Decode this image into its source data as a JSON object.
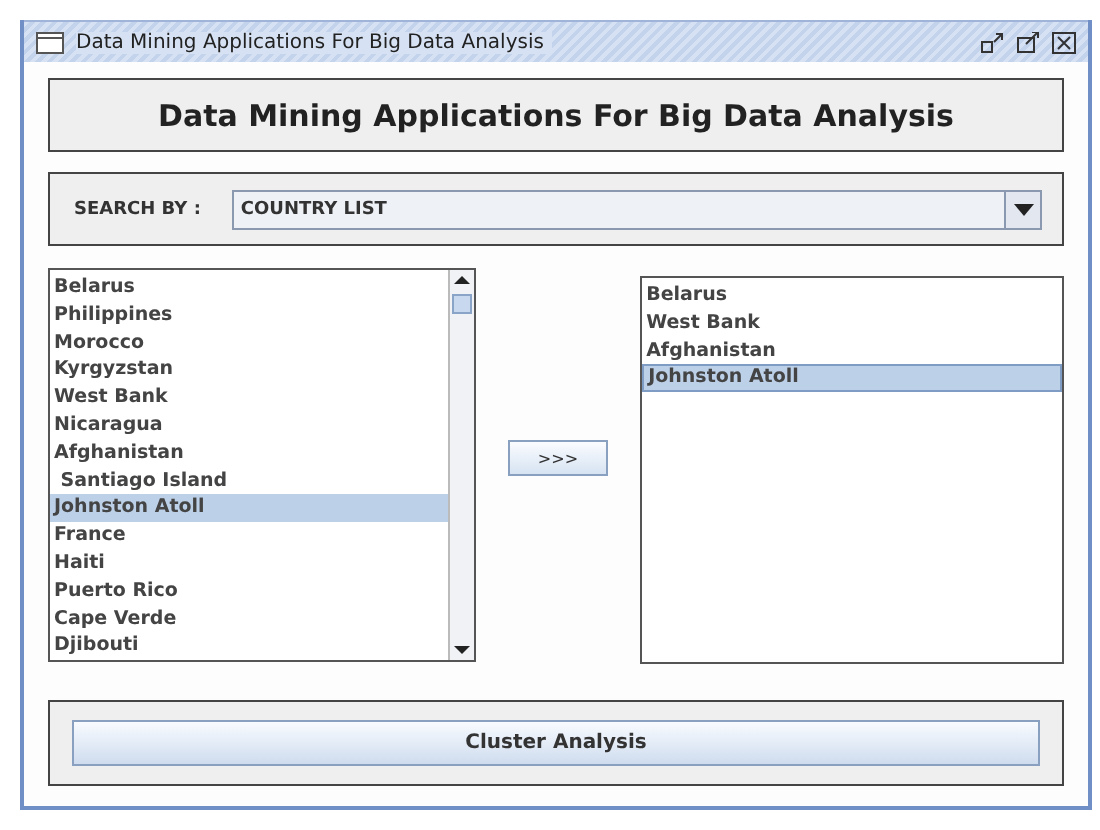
{
  "window": {
    "title": "Data Mining Applications For Big Data Analysis"
  },
  "header": {
    "title": "Data Mining Applications For Big Data Analysis"
  },
  "search": {
    "label": "SEARCH BY :",
    "value": "COUNTRY LIST"
  },
  "source_list": {
    "items": [
      {
        "label": "Belarus",
        "selected": false
      },
      {
        "label": "Philippines",
        "selected": false
      },
      {
        "label": "Morocco",
        "selected": false
      },
      {
        "label": "Kyrgyzstan",
        "selected": false
      },
      {
        "label": "West Bank",
        "selected": false
      },
      {
        "label": "Nicaragua",
        "selected": false
      },
      {
        "label": "Afghanistan",
        "selected": false
      },
      {
        "label": " Santiago Island",
        "selected": false
      },
      {
        "label": "Johnston Atoll",
        "selected": true
      },
      {
        "label": "France",
        "selected": false
      },
      {
        "label": "Haiti",
        "selected": false
      },
      {
        "label": "Puerto Rico",
        "selected": false
      },
      {
        "label": "Cape Verde",
        "selected": false
      },
      {
        "label": "Djibouti",
        "selected": false
      }
    ]
  },
  "move_button": {
    "label": ">>>"
  },
  "target_list": {
    "items": [
      {
        "label": "Belarus",
        "selected": false
      },
      {
        "label": "West Bank",
        "selected": false
      },
      {
        "label": "Afghanistan",
        "selected": false
      },
      {
        "label": "Johnston Atoll",
        "selected": true
      }
    ]
  },
  "action_button": {
    "label": "Cluster Analysis"
  }
}
